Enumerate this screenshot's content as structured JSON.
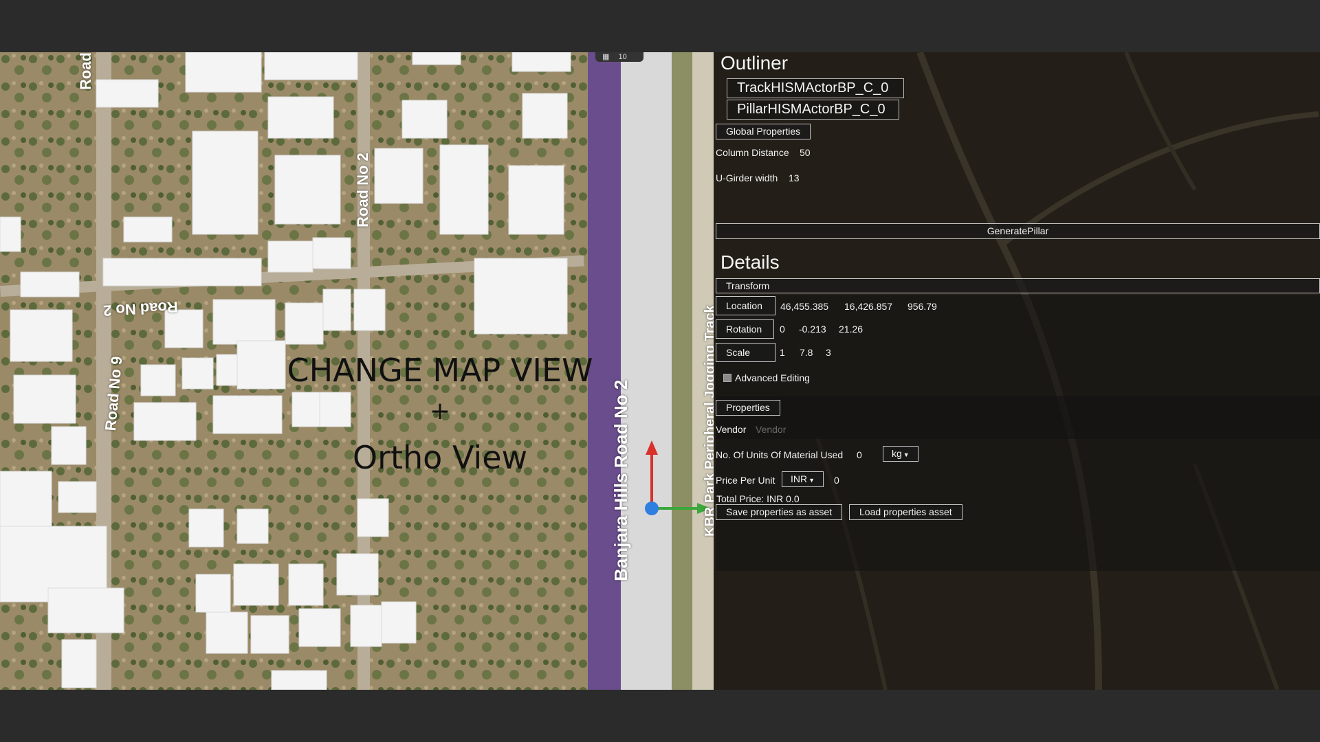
{
  "map": {
    "overlay_lines": [
      "CHANGE MAP VIEW",
      "+",
      "Ortho View"
    ],
    "road_labels": {
      "road_top": "Road",
      "road_no2_vertical": "Road No 2",
      "road_no2_flipped": "Road No 2",
      "road_no9": "Road No 9",
      "banjara": "Banjara Hills Road No 2",
      "krbr": "KBR Park Peripheral Jogging Track"
    },
    "view_toggle": {
      "icon": "grid-icon",
      "value": "10"
    }
  },
  "outliner": {
    "title": "Outliner",
    "items": [
      "TrackHISMActorBP_C_0",
      "PillarHISMActorBP_C_0"
    ],
    "global_properties_label": "Global Properties",
    "column_distance_label": "Column Distance",
    "column_distance_value": "50",
    "ugirder_label": "U-Girder width",
    "ugirder_value": "13",
    "generate_label": "GeneratePillar"
  },
  "details": {
    "title": "Details",
    "transform_label": "Transform",
    "location": {
      "label": "Location",
      "x": "46,455.385",
      "y": "16,426.857",
      "z": "956.79"
    },
    "rotation": {
      "label": "Rotation",
      "x": "0",
      "y": "-0.213",
      "z": "21.26"
    },
    "scale": {
      "label": "Scale",
      "x": "1",
      "y": "7.8",
      "z": "3"
    },
    "advanced_editing_label": "Advanced Editing",
    "properties_label": "Properties",
    "vendor_label": "Vendor",
    "vendor_placeholder": "Vendor",
    "units_label": "No. Of Units Of Material Used",
    "units_value": "0",
    "units_unit": "kg",
    "price_label": "Price Per Unit",
    "currency": "INR",
    "price_value": "0",
    "total_price": "Total Price: INR 0.0",
    "save_label": "Save properties as asset",
    "load_label": "Load properties asset"
  },
  "colors": {
    "gizmo_x": "#3aa83a",
    "gizmo_y": "#d8322a",
    "gizmo_origin": "#2f7fe0",
    "road_purple": "#7a5aa8"
  }
}
